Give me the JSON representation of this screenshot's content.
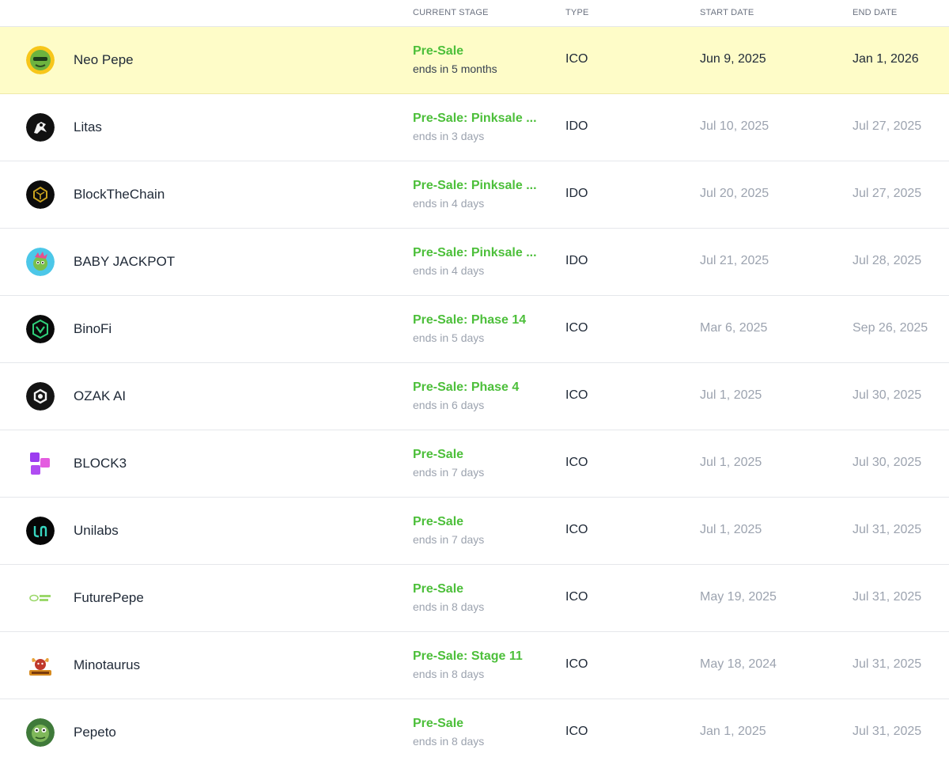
{
  "header": {
    "stage": "CURRENT STAGE",
    "type": "TYPE",
    "start_date": "START DATE",
    "end_date": "END DATE"
  },
  "rows": [
    {
      "name": "Neo Pepe",
      "stage": "Pre-Sale",
      "ends": "ends in 5 months",
      "type": "ICO",
      "start": "Jun 9, 2025",
      "end": "Jan 1, 2026",
      "icon": "neo-pepe-logo",
      "highlight": true
    },
    {
      "name": "Litas",
      "stage": "Pre-Sale: Pinksale ...",
      "ends": "ends in 3 days",
      "type": "IDO",
      "start": "Jul 10, 2025",
      "end": "Jul 27, 2025",
      "icon": "litas-logo"
    },
    {
      "name": "BlockTheChain",
      "stage": "Pre-Sale: Pinksale ...",
      "ends": "ends in 4 days",
      "type": "IDO",
      "start": "Jul 20, 2025",
      "end": "Jul 27, 2025",
      "icon": "blockthechain-logo"
    },
    {
      "name": "BABY JACKPOT",
      "stage": "Pre-Sale: Pinksale ...",
      "ends": "ends in 4 days",
      "type": "IDO",
      "start": "Jul 21, 2025",
      "end": "Jul 28, 2025",
      "icon": "baby-jackpot-logo"
    },
    {
      "name": "BinoFi",
      "stage": "Pre-Sale: Phase 14",
      "ends": "ends in 5 days",
      "type": "ICO",
      "start": "Mar 6, 2025",
      "end": "Sep 26, 2025",
      "icon": "binofi-logo"
    },
    {
      "name": "OZAK AI",
      "stage": "Pre-Sale: Phase 4",
      "ends": "ends in 6 days",
      "type": "ICO",
      "start": "Jul 1, 2025",
      "end": "Jul 30, 2025",
      "icon": "ozak-ai-logo"
    },
    {
      "name": "BLOCK3",
      "stage": "Pre-Sale",
      "ends": "ends in 7 days",
      "type": "ICO",
      "start": "Jul 1, 2025",
      "end": "Jul 30, 2025",
      "icon": "block3-logo"
    },
    {
      "name": "Unilabs",
      "stage": "Pre-Sale",
      "ends": "ends in 7 days",
      "type": "ICO",
      "start": "Jul 1, 2025",
      "end": "Jul 31, 2025",
      "icon": "unilabs-logo"
    },
    {
      "name": "FuturePepe",
      "stage": "Pre-Sale",
      "ends": "ends in 8 days",
      "type": "ICO",
      "start": "May 19, 2025",
      "end": "Jul 31, 2025",
      "icon": "futurepepe-logo"
    },
    {
      "name": "Minotaurus",
      "stage": "Pre-Sale: Stage 11",
      "ends": "ends in 8 days",
      "type": "ICO",
      "start": "May 18, 2024",
      "end": "Jul 31, 2025",
      "icon": "minotaurus-logo"
    },
    {
      "name": "Pepeto",
      "stage": "Pre-Sale",
      "ends": "ends in 8 days",
      "type": "ICO",
      "start": "Jan 1, 2025",
      "end": "Jul 31, 2025",
      "icon": "pepeto-logo"
    }
  ],
  "colors": {
    "stage_green": "#4cbf3a",
    "highlight_row": "#fefcc8",
    "muted_text": "#9ca3af",
    "divider": "#e5e7eb"
  }
}
